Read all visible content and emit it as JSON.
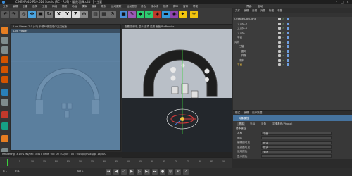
{
  "window": {
    "title": "CINEMA 4D R19.024 Studio (RC - R19) - [圆形面具.c4d *] - 主要",
    "controls": [
      "–",
      "□",
      "✕"
    ]
  },
  "menu": [
    "文件",
    "编辑",
    "创建",
    "选择",
    "工具",
    "网格",
    "捕捉",
    "动画",
    "模拟",
    "渲染",
    "雕刻",
    "运动跟踪",
    "运动图形",
    "角色",
    "流水线",
    "插件",
    "脚本",
    "窗口",
    "帮助",
    "界面:",
    "启动"
  ],
  "toolbar": {
    "axis_buttons": [
      "X",
      "Y",
      "Z"
    ]
  },
  "viewport_left": {
    "header": "Live Viewer 2.0 (v2) 卡顿3D预览版中文汉化版",
    "sub_header": "Live Viewer"
  },
  "viewport_right": {
    "header": "查看 摄像机 显示 选项 过滤 面板 ProRender",
    "footer_left": "网格间距 : 100 cm"
  },
  "object_manager": {
    "tabs": [
      "文件",
      "编辑",
      "查看",
      "对象",
      "标签",
      "书签"
    ],
    "rows": [
      {
        "name": "Octane DayLight",
        "indent": 2,
        "color": "#d0d0d0"
      },
      {
        "name": "立方体.2",
        "indent": 6,
        "color": "#d0d0d0"
      },
      {
        "name": "立方体.1",
        "indent": 6,
        "color": "#d0d0d0"
      },
      {
        "name": "立方体",
        "indent": 6,
        "color": "#d0d0d0"
      },
      {
        "name": "平面",
        "indent": 6,
        "color": "#d0d0d0"
      },
      {
        "name": "对称",
        "indent": 2,
        "color": "#d0d0d0"
      },
      {
        "name": "扫描",
        "indent": 8,
        "color": "#d0d0d0"
      },
      {
        "name": "圆环",
        "indent": 12,
        "color": "#d0d0d0"
      },
      {
        "name": "样条",
        "indent": 12,
        "color": "#d0d0d0"
      },
      {
        "name": "球体",
        "indent": 8,
        "color": "#d0d0d0"
      },
      {
        "name": "平面",
        "indent": 6,
        "color": "#f0c040"
      }
    ]
  },
  "attribute_manager": {
    "tabs": [
      "模式",
      "编辑",
      "用户数据"
    ],
    "panel_title": "对象属性",
    "panel_tabs": [
      "基本",
      "坐标",
      "对象",
      "平滑着色(Phong)"
    ],
    "section": "基本属性",
    "fields": [
      {
        "label": "名称",
        "value": "平面"
      },
      {
        "label": "图层",
        "value": ""
      },
      {
        "label": "编辑器可见",
        "value": "默认"
      },
      {
        "label": "渲染器可见",
        "value": "默认"
      },
      {
        "label": "使用颜色",
        "value": "关闭"
      },
      {
        "label": "显示颜色",
        "value": ""
      }
    ]
  },
  "status": {
    "text": "Rendering: 3.15%   Ms/sec: 3.517   Time: 00 : 00 : 00/00 : 00 : 04   Spp/maxspp: 16/500"
  },
  "timeline": {
    "ticks": [
      "0",
      "5",
      "10",
      "15",
      "20",
      "25",
      "30",
      "35",
      "40",
      "45",
      "50",
      "55",
      "60",
      "65",
      "70",
      "75",
      "80",
      "85",
      "90"
    ],
    "start": "0 F",
    "current": "0 F",
    "end": "90 F"
  },
  "transport": [
    "⏮",
    "◀",
    "◁",
    "▶",
    "▷",
    "▶|",
    "⏭",
    "●",
    "◎",
    "P",
    "?"
  ]
}
